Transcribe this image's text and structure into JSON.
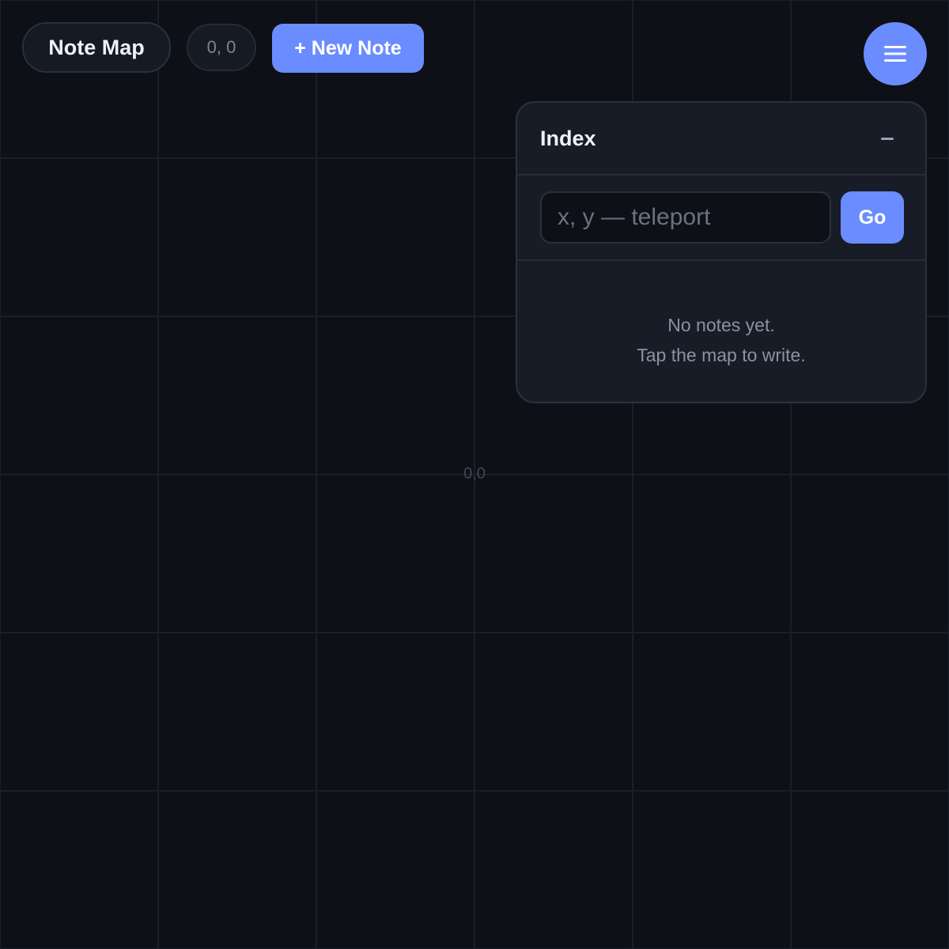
{
  "app": {
    "title": "Note Map",
    "coordinates": "0, 0",
    "new_note_label": "+ New Note"
  },
  "map": {
    "origin_label": "0,0"
  },
  "menu": {
    "icon": "hamburger-menu-icon"
  },
  "index_panel": {
    "title": "Index",
    "collapse_icon": "minus-icon",
    "teleport_placeholder": "x, y — teleport",
    "teleport_value": "",
    "go_label": "Go",
    "empty_line1": "No notes yet.",
    "empty_line2": "Tap the map to write."
  },
  "colors": {
    "background": "#0d1016",
    "accent": "#6b8cff",
    "panel": "#171c26",
    "text": "#eef1f6",
    "muted": "#8a92a2"
  }
}
